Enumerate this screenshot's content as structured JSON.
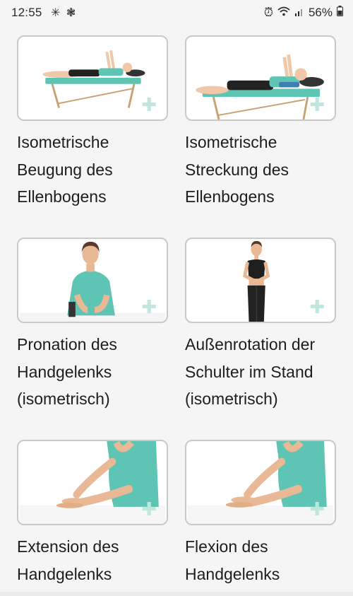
{
  "status_bar": {
    "time": "12:55",
    "battery": "56%",
    "left_icons": [
      "bluetooth-icon",
      "fan-icon"
    ],
    "right_icons": [
      "alarm-icon",
      "wifi-icon",
      "signal-icon",
      "battery-icon"
    ]
  },
  "exercises": [
    {
      "title": "Isometrische Beugung des Ellenbogens",
      "lines": [
        "Isometrische",
        "Beugung des",
        "Ellenbogens"
      ]
    },
    {
      "title": "Isometrische Streckung des Ellenbogens",
      "lines": [
        "Isometrische",
        "Streckung des",
        "Ellenbogens"
      ]
    },
    {
      "title": "Pronation des Handgelenks (isometrisch)",
      "lines": [
        "Pronation des",
        "Handgelenks",
        "(isometrisch)"
      ]
    },
    {
      "title": "Außenrotation der Schulter im Stand (isometrisch)",
      "lines": [
        "Außenrotation der",
        "Schulter im Stand",
        "(isometrisch)"
      ]
    },
    {
      "title": "Extension des Handgelenks",
      "lines": [
        "Extension des",
        "Handgelenks"
      ]
    },
    {
      "title": "Flexion des Handgelenks",
      "lines": [
        "Flexion des",
        "Handgelenks"
      ]
    }
  ],
  "colors": {
    "accent_teal": "#5ec4b4",
    "plus_icon": "#bfe7df",
    "background": "#f4f5f4"
  }
}
